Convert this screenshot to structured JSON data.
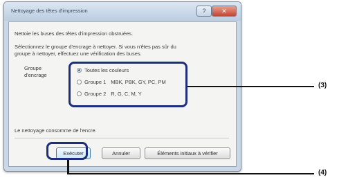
{
  "dialog": {
    "title": "Nettoyage des têtes d'impression",
    "help_label": "?",
    "close_label": "✕",
    "instruction_1": "Nettoie les buses des têtes d'impression obstruées.",
    "instruction_2_line1": "Sélectionnez le groupe d'encrage à nettoyer. Si vous n'êtes pas sûr du",
    "instruction_2_line2": "groupe à nettoyer, effectuez une vérification des buses.",
    "group_label_line1": "Groupe",
    "group_label_line2": "d'encrage",
    "options": [
      {
        "label": "Toutes les couleurs",
        "detail": "",
        "selected": true
      },
      {
        "label": "Groupe 1",
        "detail": "MBK, PBK, GY, PC, PM",
        "selected": false
      },
      {
        "label": "Groupe 2",
        "detail": "R, G, C, M, Y",
        "selected": false
      }
    ],
    "note": "Le nettoyage consomme de l'encre.",
    "buttons": {
      "execute": "Exécuter",
      "cancel": "Annuler",
      "check_items": "Éléments initiaux à vérifier"
    }
  },
  "callouts": {
    "options_group": "(3)",
    "execute_button": "(4)"
  },
  "colors": {
    "highlight": "#1c2e7c",
    "dialog_frame": "#c9d7e6",
    "close_button": "#c24631"
  }
}
